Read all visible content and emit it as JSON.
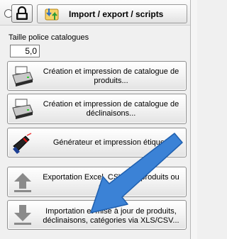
{
  "toolbar": {
    "import_export_label": "Import / export / scripts"
  },
  "font_size": {
    "label": "Taille police catalogues",
    "value": "5,0"
  },
  "actions": [
    {
      "line1": "Création et impression de catalogue de",
      "line2": "produits...",
      "icon": "printer-icon"
    },
    {
      "line1": "Création et impression de catalogue de",
      "line2": "déclinaisons...",
      "icon": "printer-icon"
    },
    {
      "line1": "Générateur et impression étiquett",
      "line2": "",
      "icon": "barcode-scanner-icon"
    },
    {
      "line1": "Exportation Excel, CSV des produits ou",
      "line2": "déclina",
      "icon": "upload-arrow-icon"
    },
    {
      "line1": "Importation et mise à jour de produits,",
      "line2": "déclinaisons, catégories via XLS/CSV...",
      "icon": "download-arrow-icon"
    }
  ],
  "colors": {
    "accent_arrow": "#3b82d6",
    "background": "#f0f0f0"
  }
}
